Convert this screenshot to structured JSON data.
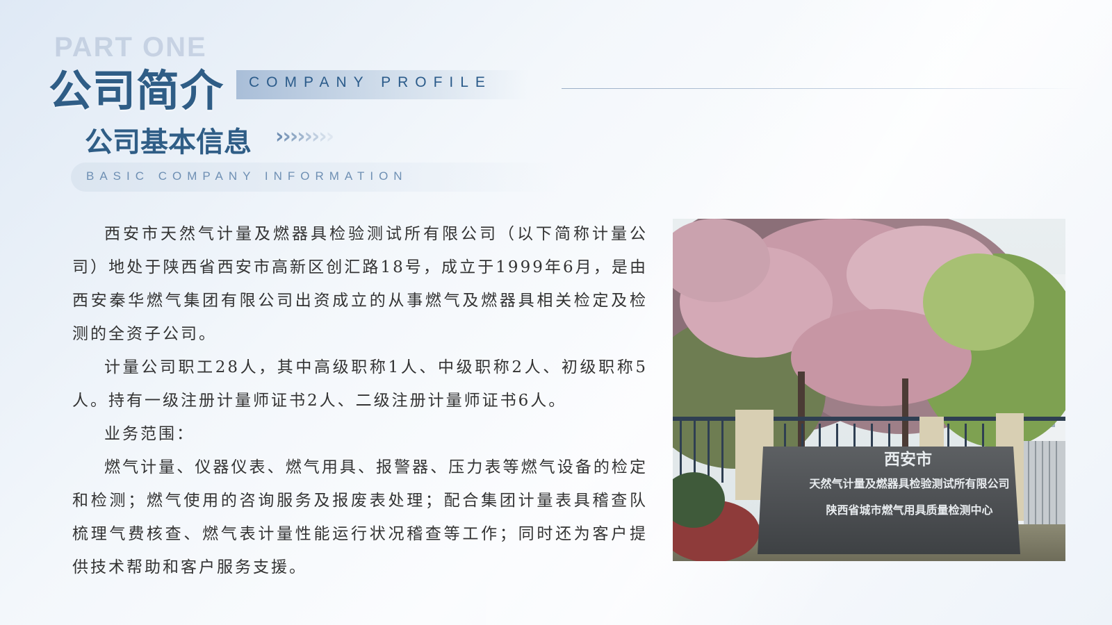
{
  "header": {
    "part_label": "PART ONE",
    "title": "公司简介",
    "title_en": "COMPANY PROFILE"
  },
  "section": {
    "title": "公司基本信息",
    "title_en": "BASIC COMPANY INFORMATION",
    "chevron": "›"
  },
  "content": {
    "paragraphs": [
      "西安市天然气计量及燃器具检验测试所有限公司（以下简称计量公司）地处于陕西省西安市高新区创汇路18号，成立于1999年6月，是由西安秦华燃气集团有限公司出资成立的从事燃气及燃器具相关检定及检测的全资子公司。",
      "计量公司职工28人，其中高级职称1人、中级职称2人、初级职称5人。持有一级注册计量师证书2人、二级注册计量师证书6人。",
      "业务范围：",
      "燃气计量、仪器仪表、燃气用具、报警器、压力表等燃气设备的检定和检测；燃气使用的咨询服务及报废表处理；配合集团计量表具稽查队梳理气费核查、燃气表计量性能运行状况稽查等工作；同时还为客户提供技术帮助和客户服务支援。"
    ]
  },
  "photo": {
    "sign_line1": "西安市",
    "sign_line2": "天然气计量及燃器具检验测试所有限公司",
    "sign_line3": "陕西省城市燃气用具质量检测中心"
  },
  "colors": {
    "accent": "#2f5d86",
    "accent_light": "#6e8fb3",
    "text": "#333333"
  }
}
